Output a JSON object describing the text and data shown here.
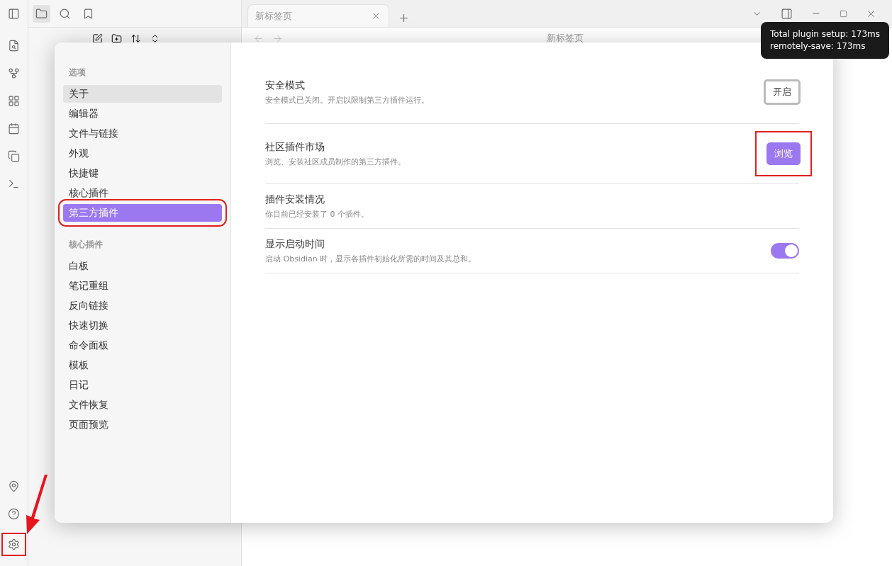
{
  "tabs": [
    {
      "label": "新标签页"
    }
  ],
  "nav_title": "新标签页",
  "tooltip": [
    "Total plugin setup: 173ms",
    "remotely-save: 173ms"
  ],
  "settings_nav": [
    {
      "heading": "选项",
      "items": [
        {
          "label": "关于",
          "selected": false,
          "hovered": true,
          "highlighted": false
        },
        {
          "label": "编辑器",
          "selected": false,
          "hovered": false,
          "highlighted": false
        },
        {
          "label": "文件与链接",
          "selected": false,
          "hovered": false,
          "highlighted": false
        },
        {
          "label": "外观",
          "selected": false,
          "hovered": false,
          "highlighted": false
        },
        {
          "label": "快捷键",
          "selected": false,
          "hovered": false,
          "highlighted": false
        },
        {
          "label": "核心插件",
          "selected": false,
          "hovered": false,
          "highlighted": false
        },
        {
          "label": "第三方插件",
          "selected": true,
          "hovered": false,
          "highlighted": true
        }
      ]
    },
    {
      "heading": "核心插件",
      "items": [
        {
          "label": "白板",
          "selected": false,
          "hovered": false,
          "highlighted": false
        },
        {
          "label": "笔记重组",
          "selected": false,
          "hovered": false,
          "highlighted": false
        },
        {
          "label": "反向链接",
          "selected": false,
          "hovered": false,
          "highlighted": false
        },
        {
          "label": "快速切换",
          "selected": false,
          "hovered": false,
          "highlighted": false
        },
        {
          "label": "命令面板",
          "selected": false,
          "hovered": false,
          "highlighted": false
        },
        {
          "label": "模板",
          "selected": false,
          "hovered": false,
          "highlighted": false
        },
        {
          "label": "日记",
          "selected": false,
          "hovered": false,
          "highlighted": false
        },
        {
          "label": "文件恢复",
          "selected": false,
          "hovered": false,
          "highlighted": false
        },
        {
          "label": "页面预览",
          "selected": false,
          "hovered": false,
          "highlighted": false
        }
      ]
    }
  ],
  "settings": [
    {
      "name": "安全模式",
      "description": "安全模式已关闭。开启以限制第三方插件运行。",
      "kind": "button",
      "button": "开启",
      "accent": false,
      "highlighted": false
    },
    {
      "name": "社区插件市场",
      "description": "浏览、安装社区成员制作的第三方插件。",
      "kind": "button",
      "button": "浏览",
      "accent": true,
      "highlighted": true
    },
    {
      "name": "插件安装情况",
      "description": "你目前已经安装了 0 个插件。",
      "kind": "info"
    },
    {
      "name": "显示启动时间",
      "description": "启动 Obsidian 时，显示各插件初始化所需的时间及其总和。",
      "kind": "toggle",
      "on": true
    }
  ],
  "settings_button_highlighted": true
}
